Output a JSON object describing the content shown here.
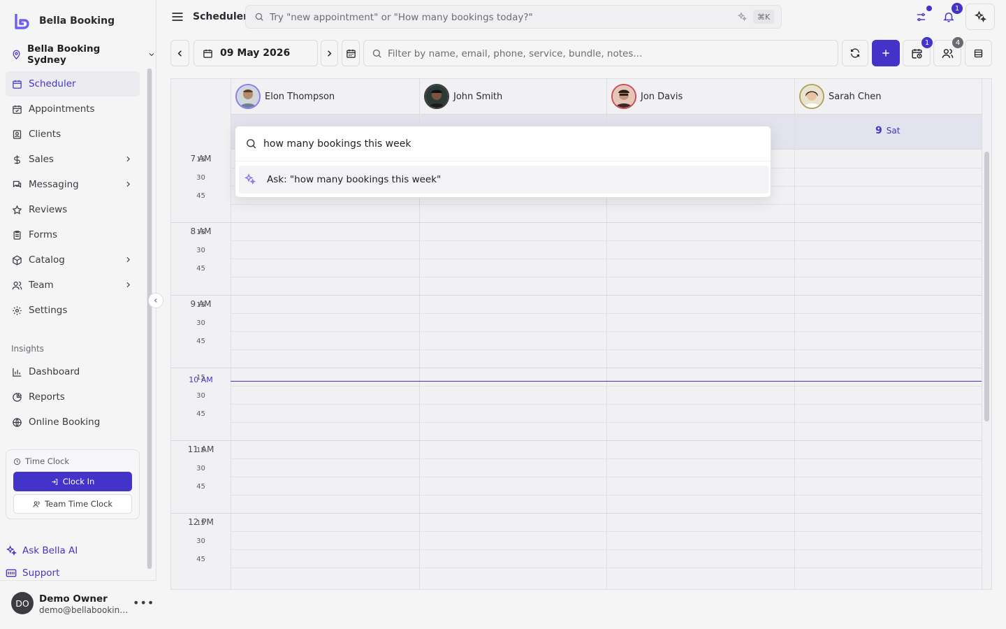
{
  "app": {
    "name": "Bella Booking",
    "location": "Bella Booking Sydney"
  },
  "nav": {
    "items": [
      {
        "label": "Scheduler",
        "icon": "calendar-icon",
        "active": true
      },
      {
        "label": "Appointments",
        "icon": "calendar-check-icon"
      },
      {
        "label": "Clients",
        "icon": "contact-icon"
      },
      {
        "label": "Sales",
        "icon": "dollar-icon",
        "submenu": true
      },
      {
        "label": "Messaging",
        "icon": "chat-icon",
        "submenu": true
      },
      {
        "label": "Reviews",
        "icon": "star-icon"
      },
      {
        "label": "Forms",
        "icon": "clipboard-icon"
      },
      {
        "label": "Catalog",
        "icon": "package-icon",
        "submenu": true
      },
      {
        "label": "Team",
        "icon": "users-icon",
        "submenu": true
      },
      {
        "label": "Settings",
        "icon": "gear-icon"
      }
    ],
    "insights_label": "Insights",
    "insights": [
      {
        "label": "Dashboard",
        "icon": "bar-chart-icon"
      },
      {
        "label": "Reports",
        "icon": "pie-chart-icon"
      },
      {
        "label": "Online Booking",
        "icon": "globe-icon"
      }
    ]
  },
  "time_clock": {
    "title": "Time Clock",
    "clock_in": "Clock In",
    "team": "Team Time Clock"
  },
  "ask_ai": "Ask Bella AI",
  "support": "Support",
  "user": {
    "initials": "DO",
    "name": "Demo Owner",
    "email": "demo@bellabooking.com.au"
  },
  "topbar": {
    "title": "Scheduler",
    "search_placeholder": "Try \"new appointment\" or \"How many bookings today?\"",
    "shortcut": "⌘K",
    "notifications_count": "1"
  },
  "toolbar": {
    "date": "09 May 2026",
    "filter_placeholder": "Filter by name, email, phone, service, bundle, notes...",
    "waitlist_count": "1",
    "staff_count": "4"
  },
  "calendar": {
    "staff": [
      {
        "name": "Elon Thompson"
      },
      {
        "name": "John Smith"
      },
      {
        "name": "Jon Davis"
      },
      {
        "name": "Sarah Chen"
      }
    ],
    "day_number": "9",
    "day_name": "Sat",
    "hours": [
      "7 AM",
      "8 AM",
      "9 AM",
      "10 AM",
      "11 AM",
      "12 PM"
    ],
    "minutes": [
      "15",
      "30",
      "45"
    ],
    "current_hour_index": 3
  },
  "popup": {
    "query": "how many bookings this week",
    "suggestion": "Ask: \"how many bookings this week\""
  },
  "colors": {
    "accent": "#4433c9",
    "background": "#f5f5f6"
  }
}
